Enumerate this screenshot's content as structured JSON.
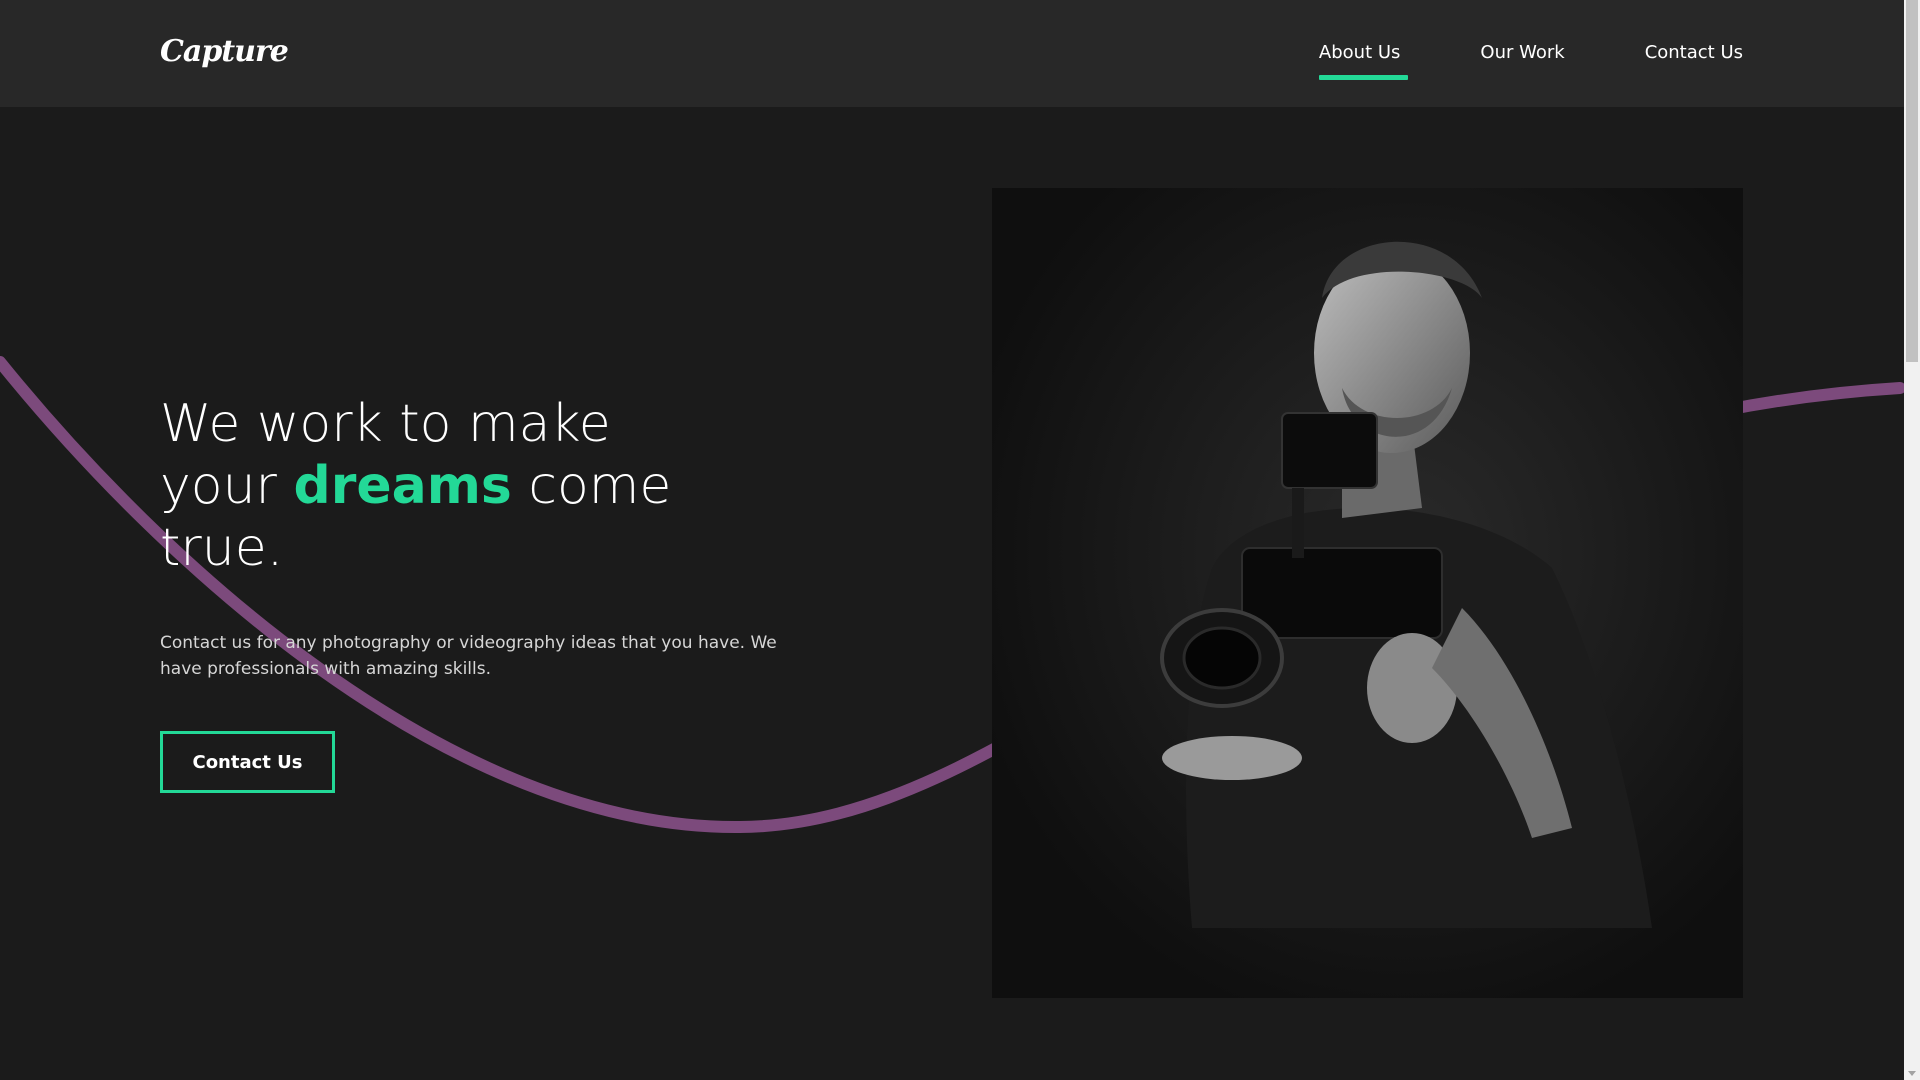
{
  "header": {
    "logo": "Capture",
    "nav": [
      {
        "label": "About Us",
        "active": true
      },
      {
        "label": "Our Work",
        "active": false
      },
      {
        "label": "Contact Us",
        "active": false
      }
    ]
  },
  "hero": {
    "title_part1": "We work to make your",
    "title_accent": "dreams",
    "title_part2": "come true.",
    "description": "Contact us for any photography or videography ideas that you have. We have professionals with amazing skills.",
    "cta_label": "Contact Us"
  },
  "colors": {
    "background": "#1b1b1b",
    "header": "#282828",
    "accent": "#23d997",
    "wave": "#7c4a7c"
  },
  "icons": {
    "scroll_down": "triangle-down"
  }
}
